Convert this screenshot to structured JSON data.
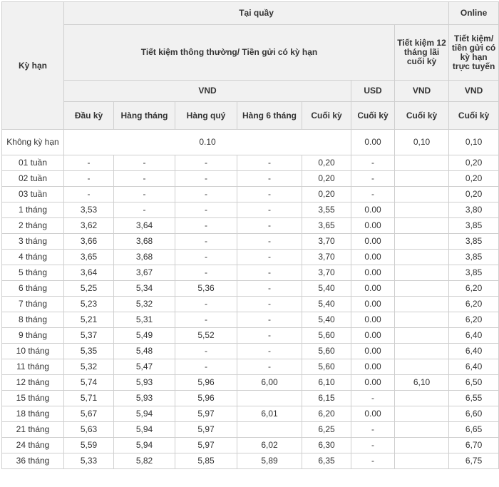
{
  "header": {
    "term": "Kỳ hạn",
    "counter": "Tại quầy",
    "online": "Online",
    "regular": "Tiết kiệm thông thường/ Tiền gửi có kỳ hạn",
    "savings12": "Tiết kiệm 12 tháng lãi cuối kỳ",
    "online_savings": "Tiết kiệm/ tiền gửi có kỳ hạn trực tuyến",
    "vnd": "VND",
    "usd": "USD",
    "cols": [
      "Đầu kỳ",
      "Hàng tháng",
      "Hàng quý",
      "Hàng 6 tháng",
      "Cuối kỳ"
    ],
    "usd_col": "Cuối kỳ",
    "savings12_col": "Cuối kỳ",
    "online_col": "Cuối  kỳ"
  },
  "demand_row": {
    "term": "Không kỳ hạn",
    "vnd": "0.10",
    "usd": "0.00",
    "savings12": "0,10",
    "online": "0,10"
  },
  "rows": [
    [
      "01 tuần",
      "-",
      "-",
      "-",
      "-",
      "0,20",
      "-",
      "",
      "0,20"
    ],
    [
      "02 tuần",
      "-",
      "-",
      "-",
      "-",
      "0,20",
      "-",
      "",
      "0,20"
    ],
    [
      "03 tuần",
      "-",
      "-",
      "-",
      "-",
      "0,20",
      "-",
      "",
      "0,20"
    ],
    [
      "1 tháng",
      "3,53",
      "-",
      "-",
      "-",
      "3,55",
      "0.00",
      "",
      "3,80"
    ],
    [
      "2 tháng",
      "3,62",
      "3,64",
      "-",
      "-",
      "3,65",
      "0.00",
      "",
      "3,85"
    ],
    [
      "3 tháng",
      "3,66",
      "3,68",
      "-",
      "-",
      "3,70",
      "0.00",
      "",
      "3,85"
    ],
    [
      "4 tháng",
      "3,65",
      "3,68",
      "-",
      "-",
      "3,70",
      "0.00",
      "",
      "3,85"
    ],
    [
      "5 tháng",
      "3,64",
      "3,67",
      "-",
      "-",
      "3,70",
      "0.00",
      "",
      "3,85"
    ],
    [
      "6 tháng",
      "5,25",
      "5,34",
      "5,36",
      "-",
      "5,40",
      "0.00",
      "",
      "6,20"
    ],
    [
      "7  tháng",
      "5,23",
      "5,32",
      "-",
      "-",
      "5,40",
      "0.00",
      "",
      "6,20"
    ],
    [
      "8 tháng",
      "5,21",
      "5,31",
      "-",
      "-",
      "5,40",
      "0.00",
      "",
      "6,20"
    ],
    [
      "9 tháng",
      "5,37",
      "5,49",
      "5,52",
      "-",
      "5,60",
      "0.00",
      "",
      "6,40"
    ],
    [
      "10 tháng",
      "5,35",
      "5,48",
      "-",
      "-",
      "5,60",
      "0.00",
      "",
      "6,40"
    ],
    [
      "11 tháng",
      "5,32",
      "5,47",
      "-",
      "-",
      "5,60",
      "0.00",
      "",
      "6,40"
    ],
    [
      "12 tháng",
      "5,74",
      "5,93",
      "5,96",
      "6,00",
      "6,10",
      "0.00",
      "6,10",
      "6,50"
    ],
    [
      "15 tháng",
      "5,71",
      "5,93",
      "5,96",
      "",
      "6,15",
      "-",
      "",
      "6,55"
    ],
    [
      "18 tháng",
      "5,67",
      "5,94",
      "5,97",
      "6,01",
      "6,20",
      "0.00",
      "",
      "6,60"
    ],
    [
      "21 tháng",
      "5,63",
      "5,94",
      "5,97",
      "",
      "6,25",
      "-",
      "",
      "6,65"
    ],
    [
      "24 tháng",
      "5,59",
      "5,94",
      "5,97",
      "6,02",
      "6,30",
      "-",
      "",
      "6,70"
    ],
    [
      "36 tháng",
      "5,33",
      "5,82",
      "5,85",
      "5,89",
      "6,35",
      "-",
      "",
      "6,75"
    ]
  ]
}
